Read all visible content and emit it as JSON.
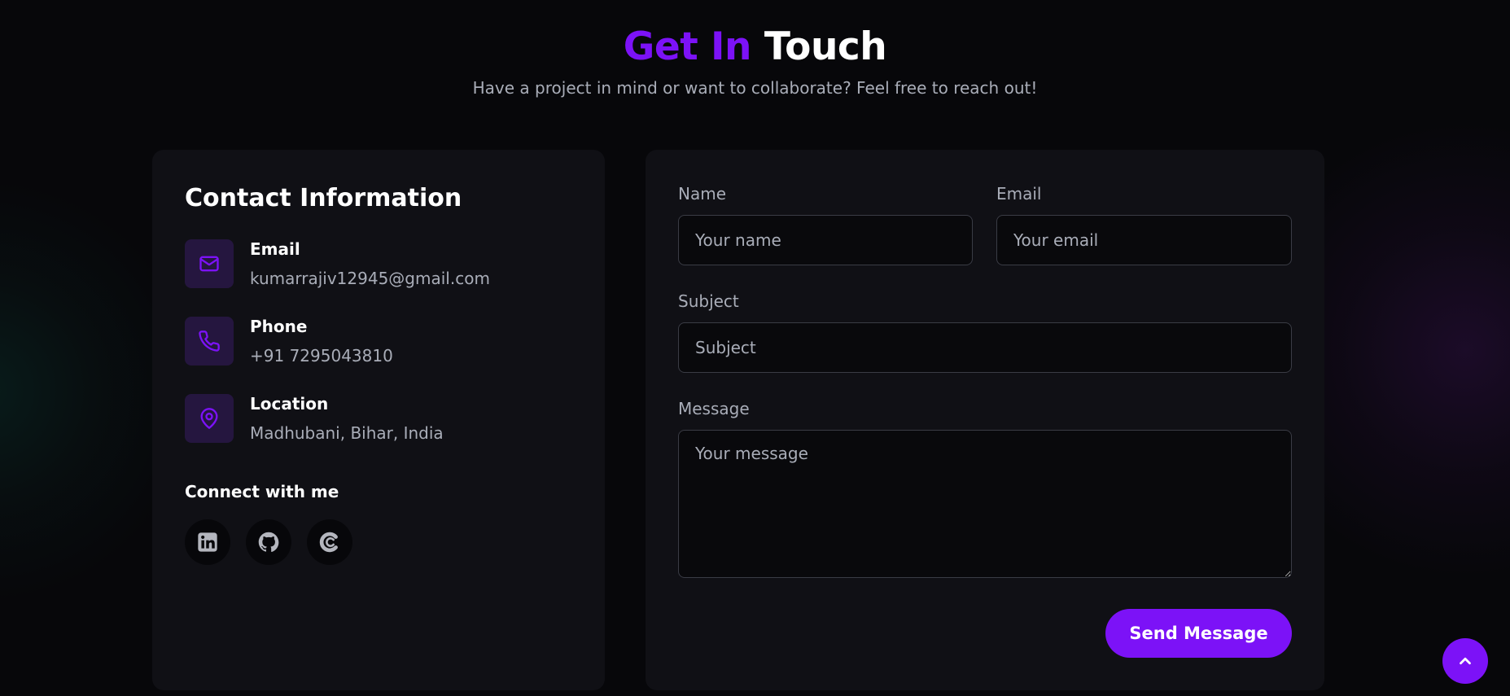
{
  "header": {
    "title_accent": "Get In",
    "title_plain": "Touch",
    "subtitle": "Have a project in mind or want to collaborate? Feel free to reach out!"
  },
  "contact_info": {
    "title": "Contact Information",
    "items": [
      {
        "label": "Email",
        "value": "kumarrajiv12945@gmail.com",
        "icon": "mail-icon"
      },
      {
        "label": "Phone",
        "value": "+91 7295043810",
        "icon": "phone-icon"
      },
      {
        "label": "Location",
        "value": "Madhubani, Bihar, India",
        "icon": "map-pin-icon"
      }
    ],
    "connect_label": "Connect with me",
    "socials": [
      {
        "name": "LinkedIn",
        "icon": "linkedin-icon"
      },
      {
        "name": "GitHub",
        "icon": "github-icon"
      },
      {
        "name": "CodeChef",
        "icon": "codechef-icon"
      }
    ]
  },
  "form": {
    "name_label": "Name",
    "name_placeholder": "Your name",
    "email_label": "Email",
    "email_placeholder": "Your email",
    "subject_label": "Subject",
    "subject_placeholder": "Subject",
    "message_label": "Message",
    "message_placeholder": "Your message",
    "submit_label": "Send Message"
  },
  "colors": {
    "accent": "#7c12f7",
    "background": "#07070a",
    "card": "#101015",
    "muted_text": "#a9adb8",
    "icon_box": "#25163f"
  },
  "scroll_top": {
    "icon": "chevron-up-icon"
  }
}
